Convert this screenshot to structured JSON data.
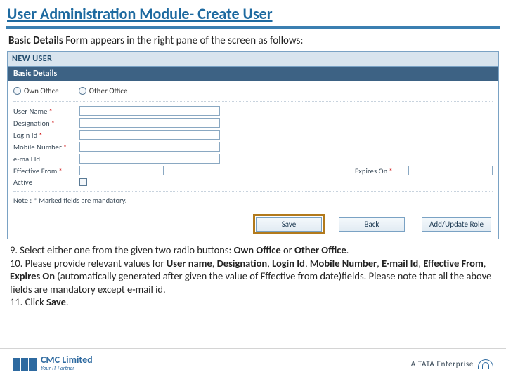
{
  "title": "User Administration Module- Create User",
  "intro": {
    "bold": "Basic Details",
    "rest": " Form appears in the right pane of the screen as follows:"
  },
  "form": {
    "header": "NEW USER",
    "section": "Basic Details",
    "radios": {
      "own": "Own Office",
      "other": "Other Office"
    },
    "labels": {
      "user_name": "User Name",
      "designation": "Designation",
      "login_id": "Login Id",
      "mobile": "Mobile Number",
      "email": "e-mail Id",
      "effective_from": "Effective From",
      "expires_on": "Expires On",
      "active": "Active"
    },
    "note": "Note : * Marked fields are mandatory.",
    "buttons": {
      "save": "Save",
      "back": "Back",
      "add_update_role": "Add/Update Role"
    }
  },
  "instructions": {
    "line9_a": "9. Select either one from the given two radio buttons: ",
    "line9_b1": "Own Office",
    "line9_mid": " or ",
    "line9_b2": "Other Office",
    "line9_end": ".",
    "line10_a": "10. Please provide relevant values for ",
    "f1": "User name",
    "c": ", ",
    "f2": "Designation",
    "f3": "Login Id",
    "f4": "Mobile Number",
    "f5": "E-mail Id",
    "f6": "Effective From",
    "f7": "Expires On",
    "line10_b": " (automatically generated after given the value of  Effective from date)fields. Please note that all the above fields are mandatory except e-mail id.",
    "line11_a": "11. Click ",
    "line11_b": "Save",
    "line11_c": "."
  },
  "footer": {
    "cmc_name": "CMC Limited",
    "cmc_tag": "Your IT Partner",
    "tata": "A TATA Enterprise"
  }
}
